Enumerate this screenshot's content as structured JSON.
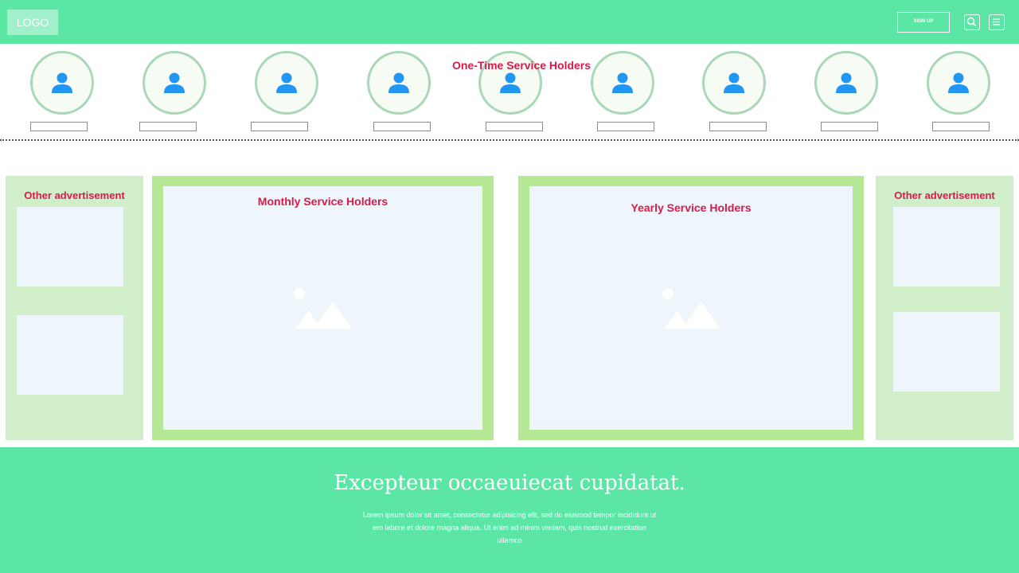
{
  "header": {
    "logo": "LOGO",
    "signup_label": "SIGN UP",
    "icons": [
      "search-icon",
      "menu-icon"
    ]
  },
  "one_time": {
    "title": "One-Time Service Holders",
    "avatar_count": 9
  },
  "left_ad": {
    "title": "Other advertisement"
  },
  "monthly": {
    "title": "Monthly Service Holders"
  },
  "yearly": {
    "title": "Yearly Service Holders"
  },
  "right_ad": {
    "title": "Other advertisement"
  },
  "footer": {
    "heading": "Excepteur occaeuiecat cupidatat.",
    "body": "Lorem ipsum dolor sit amet, consectetur adipisicing elit, sed do eiusmod tempor incididunt ut ero labore et dolore magna aliqua. Ut enim ad minim veniam, quis nostrud exercitation ullamco"
  },
  "colors": {
    "header_bg": "#5ce6a6",
    "title_red": "#d81b4a",
    "panel_green": "#b5e894",
    "side_green": "#cfeec9",
    "avatar_blue": "#2196f3"
  }
}
